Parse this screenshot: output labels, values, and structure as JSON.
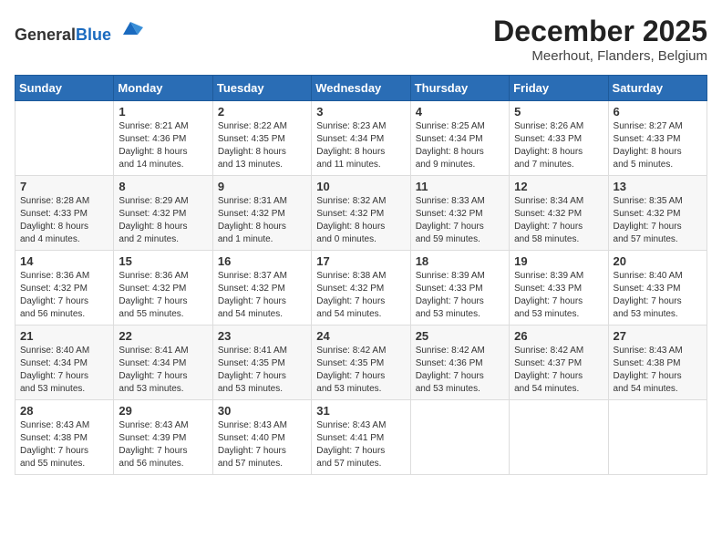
{
  "header": {
    "logo_general": "General",
    "logo_blue": "Blue",
    "month": "December 2025",
    "location": "Meerhout, Flanders, Belgium"
  },
  "weekdays": [
    "Sunday",
    "Monday",
    "Tuesday",
    "Wednesday",
    "Thursday",
    "Friday",
    "Saturday"
  ],
  "weeks": [
    [
      {
        "day": "",
        "info": ""
      },
      {
        "day": "1",
        "info": "Sunrise: 8:21 AM\nSunset: 4:36 PM\nDaylight: 8 hours\nand 14 minutes."
      },
      {
        "day": "2",
        "info": "Sunrise: 8:22 AM\nSunset: 4:35 PM\nDaylight: 8 hours\nand 13 minutes."
      },
      {
        "day": "3",
        "info": "Sunrise: 8:23 AM\nSunset: 4:34 PM\nDaylight: 8 hours\nand 11 minutes."
      },
      {
        "day": "4",
        "info": "Sunrise: 8:25 AM\nSunset: 4:34 PM\nDaylight: 8 hours\nand 9 minutes."
      },
      {
        "day": "5",
        "info": "Sunrise: 8:26 AM\nSunset: 4:33 PM\nDaylight: 8 hours\nand 7 minutes."
      },
      {
        "day": "6",
        "info": "Sunrise: 8:27 AM\nSunset: 4:33 PM\nDaylight: 8 hours\nand 5 minutes."
      }
    ],
    [
      {
        "day": "7",
        "info": "Sunrise: 8:28 AM\nSunset: 4:33 PM\nDaylight: 8 hours\nand 4 minutes."
      },
      {
        "day": "8",
        "info": "Sunrise: 8:29 AM\nSunset: 4:32 PM\nDaylight: 8 hours\nand 2 minutes."
      },
      {
        "day": "9",
        "info": "Sunrise: 8:31 AM\nSunset: 4:32 PM\nDaylight: 8 hours\nand 1 minute."
      },
      {
        "day": "10",
        "info": "Sunrise: 8:32 AM\nSunset: 4:32 PM\nDaylight: 8 hours\nand 0 minutes."
      },
      {
        "day": "11",
        "info": "Sunrise: 8:33 AM\nSunset: 4:32 PM\nDaylight: 7 hours\nand 59 minutes."
      },
      {
        "day": "12",
        "info": "Sunrise: 8:34 AM\nSunset: 4:32 PM\nDaylight: 7 hours\nand 58 minutes."
      },
      {
        "day": "13",
        "info": "Sunrise: 8:35 AM\nSunset: 4:32 PM\nDaylight: 7 hours\nand 57 minutes."
      }
    ],
    [
      {
        "day": "14",
        "info": "Sunrise: 8:36 AM\nSunset: 4:32 PM\nDaylight: 7 hours\nand 56 minutes."
      },
      {
        "day": "15",
        "info": "Sunrise: 8:36 AM\nSunset: 4:32 PM\nDaylight: 7 hours\nand 55 minutes."
      },
      {
        "day": "16",
        "info": "Sunrise: 8:37 AM\nSunset: 4:32 PM\nDaylight: 7 hours\nand 54 minutes."
      },
      {
        "day": "17",
        "info": "Sunrise: 8:38 AM\nSunset: 4:32 PM\nDaylight: 7 hours\nand 54 minutes."
      },
      {
        "day": "18",
        "info": "Sunrise: 8:39 AM\nSunset: 4:33 PM\nDaylight: 7 hours\nand 53 minutes."
      },
      {
        "day": "19",
        "info": "Sunrise: 8:39 AM\nSunset: 4:33 PM\nDaylight: 7 hours\nand 53 minutes."
      },
      {
        "day": "20",
        "info": "Sunrise: 8:40 AM\nSunset: 4:33 PM\nDaylight: 7 hours\nand 53 minutes."
      }
    ],
    [
      {
        "day": "21",
        "info": "Sunrise: 8:40 AM\nSunset: 4:34 PM\nDaylight: 7 hours\nand 53 minutes."
      },
      {
        "day": "22",
        "info": "Sunrise: 8:41 AM\nSunset: 4:34 PM\nDaylight: 7 hours\nand 53 minutes."
      },
      {
        "day": "23",
        "info": "Sunrise: 8:41 AM\nSunset: 4:35 PM\nDaylight: 7 hours\nand 53 minutes."
      },
      {
        "day": "24",
        "info": "Sunrise: 8:42 AM\nSunset: 4:35 PM\nDaylight: 7 hours\nand 53 minutes."
      },
      {
        "day": "25",
        "info": "Sunrise: 8:42 AM\nSunset: 4:36 PM\nDaylight: 7 hours\nand 53 minutes."
      },
      {
        "day": "26",
        "info": "Sunrise: 8:42 AM\nSunset: 4:37 PM\nDaylight: 7 hours\nand 54 minutes."
      },
      {
        "day": "27",
        "info": "Sunrise: 8:43 AM\nSunset: 4:38 PM\nDaylight: 7 hours\nand 54 minutes."
      }
    ],
    [
      {
        "day": "28",
        "info": "Sunrise: 8:43 AM\nSunset: 4:38 PM\nDaylight: 7 hours\nand 55 minutes."
      },
      {
        "day": "29",
        "info": "Sunrise: 8:43 AM\nSunset: 4:39 PM\nDaylight: 7 hours\nand 56 minutes."
      },
      {
        "day": "30",
        "info": "Sunrise: 8:43 AM\nSunset: 4:40 PM\nDaylight: 7 hours\nand 57 minutes."
      },
      {
        "day": "31",
        "info": "Sunrise: 8:43 AM\nSunset: 4:41 PM\nDaylight: 7 hours\nand 57 minutes."
      },
      {
        "day": "",
        "info": ""
      },
      {
        "day": "",
        "info": ""
      },
      {
        "day": "",
        "info": ""
      }
    ]
  ]
}
